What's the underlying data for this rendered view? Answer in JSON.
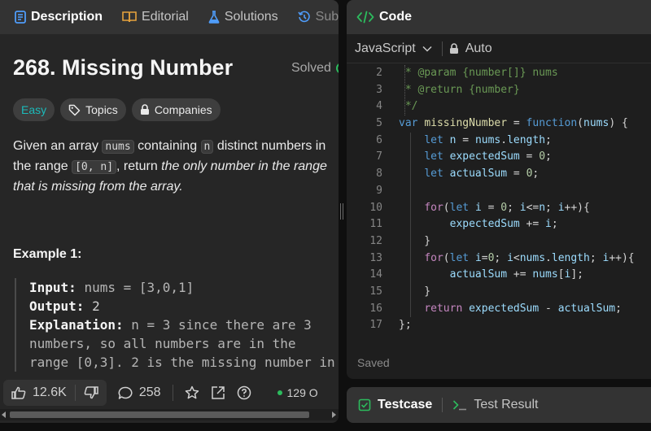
{
  "left_tabs": [
    {
      "label": "Description",
      "icon": "description-icon"
    },
    {
      "label": "Editorial",
      "icon": "book-icon"
    },
    {
      "label": "Solutions",
      "icon": "flask-icon"
    },
    {
      "label": "Sub",
      "icon": "history-icon"
    }
  ],
  "problem": {
    "title": "268. Missing Number",
    "status": "Solved",
    "difficulty": "Easy",
    "topics_label": "Topics",
    "companies_label": "Companies",
    "desc": {
      "t1": "Given an array ",
      "c1": "nums",
      "t2": " containing ",
      "c2": "n",
      "t3": " distinct numbers in the range ",
      "c3": "[0, n]",
      "t4": ", return ",
      "t5": "the only number in the range that is missing from the array."
    },
    "example_title": "Example 1:",
    "example": {
      "input_label": "Input:",
      "input_value": "nums = [3,0,1]",
      "output_label": "Output:",
      "output_value": "2",
      "explanation_label": "Explanation:",
      "explanation_lines": [
        "n = 3 since there are 3",
        "numbers, so all numbers are in the",
        "range [0,3]. 2 is the missing number in"
      ]
    }
  },
  "bottom_bar": {
    "likes": "12.6K",
    "comments": "258",
    "online": "129 O"
  },
  "code": {
    "header_title": "Code",
    "language": "JavaScript",
    "mode": "Auto",
    "saved_label": "Saved",
    "lines": [
      {
        "n": "2",
        "tokens": [
          {
            "c": "cm",
            "t": " * @param {number[]} nums"
          }
        ]
      },
      {
        "n": "3",
        "tokens": [
          {
            "c": "cm",
            "t": " * @return {number}"
          }
        ]
      },
      {
        "n": "4",
        "tokens": [
          {
            "c": "cm",
            "t": " */"
          }
        ]
      },
      {
        "n": "5",
        "tokens": [
          {
            "c": "kw",
            "t": "var"
          },
          {
            "c": "",
            "t": " "
          },
          {
            "c": "fn",
            "t": "missingNumber"
          },
          {
            "c": "",
            "t": " = "
          },
          {
            "c": "kw",
            "t": "function"
          },
          {
            "c": "",
            "t": "("
          },
          {
            "c": "id",
            "t": "nums"
          },
          {
            "c": "",
            "t": ") {"
          }
        ]
      },
      {
        "n": "6",
        "tokens": [
          {
            "c": "",
            "t": "    "
          },
          {
            "c": "kw",
            "t": "let"
          },
          {
            "c": "",
            "t": " "
          },
          {
            "c": "id",
            "t": "n"
          },
          {
            "c": "",
            "t": " = "
          },
          {
            "c": "id",
            "t": "nums"
          },
          {
            "c": "",
            "t": "."
          },
          {
            "c": "id",
            "t": "length"
          },
          {
            "c": "",
            "t": ";"
          }
        ]
      },
      {
        "n": "7",
        "tokens": [
          {
            "c": "",
            "t": "    "
          },
          {
            "c": "kw",
            "t": "let"
          },
          {
            "c": "",
            "t": " "
          },
          {
            "c": "id",
            "t": "expectedSum"
          },
          {
            "c": "",
            "t": " = "
          },
          {
            "c": "num",
            "t": "0"
          },
          {
            "c": "",
            "t": ";"
          }
        ]
      },
      {
        "n": "8",
        "tokens": [
          {
            "c": "",
            "t": "    "
          },
          {
            "c": "kw",
            "t": "let"
          },
          {
            "c": "",
            "t": " "
          },
          {
            "c": "id",
            "t": "actualSum"
          },
          {
            "c": "",
            "t": " = "
          },
          {
            "c": "num",
            "t": "0"
          },
          {
            "c": "",
            "t": ";"
          }
        ]
      },
      {
        "n": "9",
        "tokens": []
      },
      {
        "n": "10",
        "tokens": [
          {
            "c": "",
            "t": "    "
          },
          {
            "c": "ctl",
            "t": "for"
          },
          {
            "c": "",
            "t": "("
          },
          {
            "c": "kw",
            "t": "let"
          },
          {
            "c": "",
            "t": " "
          },
          {
            "c": "id",
            "t": "i"
          },
          {
            "c": "",
            "t": " = "
          },
          {
            "c": "num",
            "t": "0"
          },
          {
            "c": "",
            "t": "; "
          },
          {
            "c": "id",
            "t": "i"
          },
          {
            "c": "",
            "t": "<="
          },
          {
            "c": "id",
            "t": "n"
          },
          {
            "c": "",
            "t": "; "
          },
          {
            "c": "id",
            "t": "i"
          },
          {
            "c": "",
            "t": "++){"
          }
        ]
      },
      {
        "n": "11",
        "tokens": [
          {
            "c": "",
            "t": "        "
          },
          {
            "c": "id",
            "t": "expectedSum"
          },
          {
            "c": "",
            "t": " += "
          },
          {
            "c": "id",
            "t": "i"
          },
          {
            "c": "",
            "t": ";"
          }
        ]
      },
      {
        "n": "12",
        "tokens": [
          {
            "c": "",
            "t": "    }"
          }
        ]
      },
      {
        "n": "13",
        "tokens": [
          {
            "c": "",
            "t": "    "
          },
          {
            "c": "ctl",
            "t": "for"
          },
          {
            "c": "",
            "t": "("
          },
          {
            "c": "kw",
            "t": "let"
          },
          {
            "c": "",
            "t": " "
          },
          {
            "c": "id",
            "t": "i"
          },
          {
            "c": "",
            "t": "="
          },
          {
            "c": "num",
            "t": "0"
          },
          {
            "c": "",
            "t": "; "
          },
          {
            "c": "id",
            "t": "i"
          },
          {
            "c": "",
            "t": "<"
          },
          {
            "c": "id",
            "t": "nums"
          },
          {
            "c": "",
            "t": "."
          },
          {
            "c": "id",
            "t": "length"
          },
          {
            "c": "",
            "t": "; "
          },
          {
            "c": "id",
            "t": "i"
          },
          {
            "c": "",
            "t": "++){"
          }
        ]
      },
      {
        "n": "14",
        "tokens": [
          {
            "c": "",
            "t": "        "
          },
          {
            "c": "id",
            "t": "actualSum"
          },
          {
            "c": "",
            "t": " += "
          },
          {
            "c": "id",
            "t": "nums"
          },
          {
            "c": "",
            "t": "["
          },
          {
            "c": "id",
            "t": "i"
          },
          {
            "c": "",
            "t": "];"
          }
        ]
      },
      {
        "n": "15",
        "tokens": [
          {
            "c": "",
            "t": "    }"
          }
        ]
      },
      {
        "n": "16",
        "tokens": [
          {
            "c": "",
            "t": "    "
          },
          {
            "c": "ctl",
            "t": "return"
          },
          {
            "c": "",
            "t": " "
          },
          {
            "c": "id",
            "t": "expectedSum"
          },
          {
            "c": "",
            "t": " - "
          },
          {
            "c": "id",
            "t": "actualSum"
          },
          {
            "c": "",
            "t": ";"
          }
        ]
      },
      {
        "n": "17",
        "tokens": [
          {
            "c": "",
            "t": "};"
          }
        ]
      }
    ]
  },
  "test_tabs": [
    {
      "label": "Testcase",
      "icon": "checkbox-icon"
    },
    {
      "label": "Test Result",
      "icon": "terminal-icon"
    }
  ],
  "colors": {
    "easy": "#1cbaba",
    "solved": "#2cbb5d",
    "code_bg": "#1e1e1e",
    "panel_bg": "#262626",
    "header_bg": "#333333"
  }
}
